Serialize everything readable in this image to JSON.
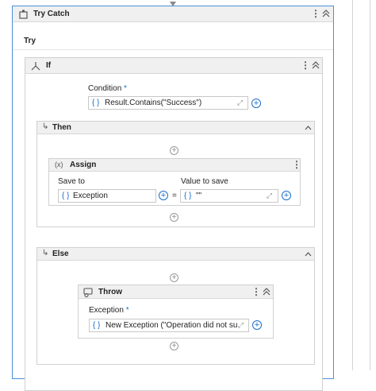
{
  "try_catch": {
    "title": "Try Catch",
    "try_label": "Try"
  },
  "if_block": {
    "title": "If",
    "condition_label": "Condition",
    "condition_required": "*",
    "condition_value": "Result.Contains(\"Success\")"
  },
  "then_block": {
    "title": "Then",
    "assign": {
      "title": "Assign",
      "icon_text": "(x)",
      "save_to_label": "Save to",
      "save_to_value": "Exception",
      "equals": "=",
      "value_label": "Value to save",
      "value_value": "\"\""
    }
  },
  "else_block": {
    "title": "Else",
    "throw": {
      "title": "Throw",
      "exception_label": "Exception",
      "exception_required": "*",
      "exception_value": "New Exception (\"Operation did not succe"
    }
  },
  "icons": {
    "brace": "{ }",
    "plus": "+",
    "kebab": "⋮",
    "collapse": "⌃⌃",
    "chevron_up": "^",
    "branch": "↳",
    "expand": "⤢"
  },
  "colors": {
    "accent": "#1a6fc9",
    "required": "#1a6fc9",
    "header_bg": "#f0f0f0"
  }
}
